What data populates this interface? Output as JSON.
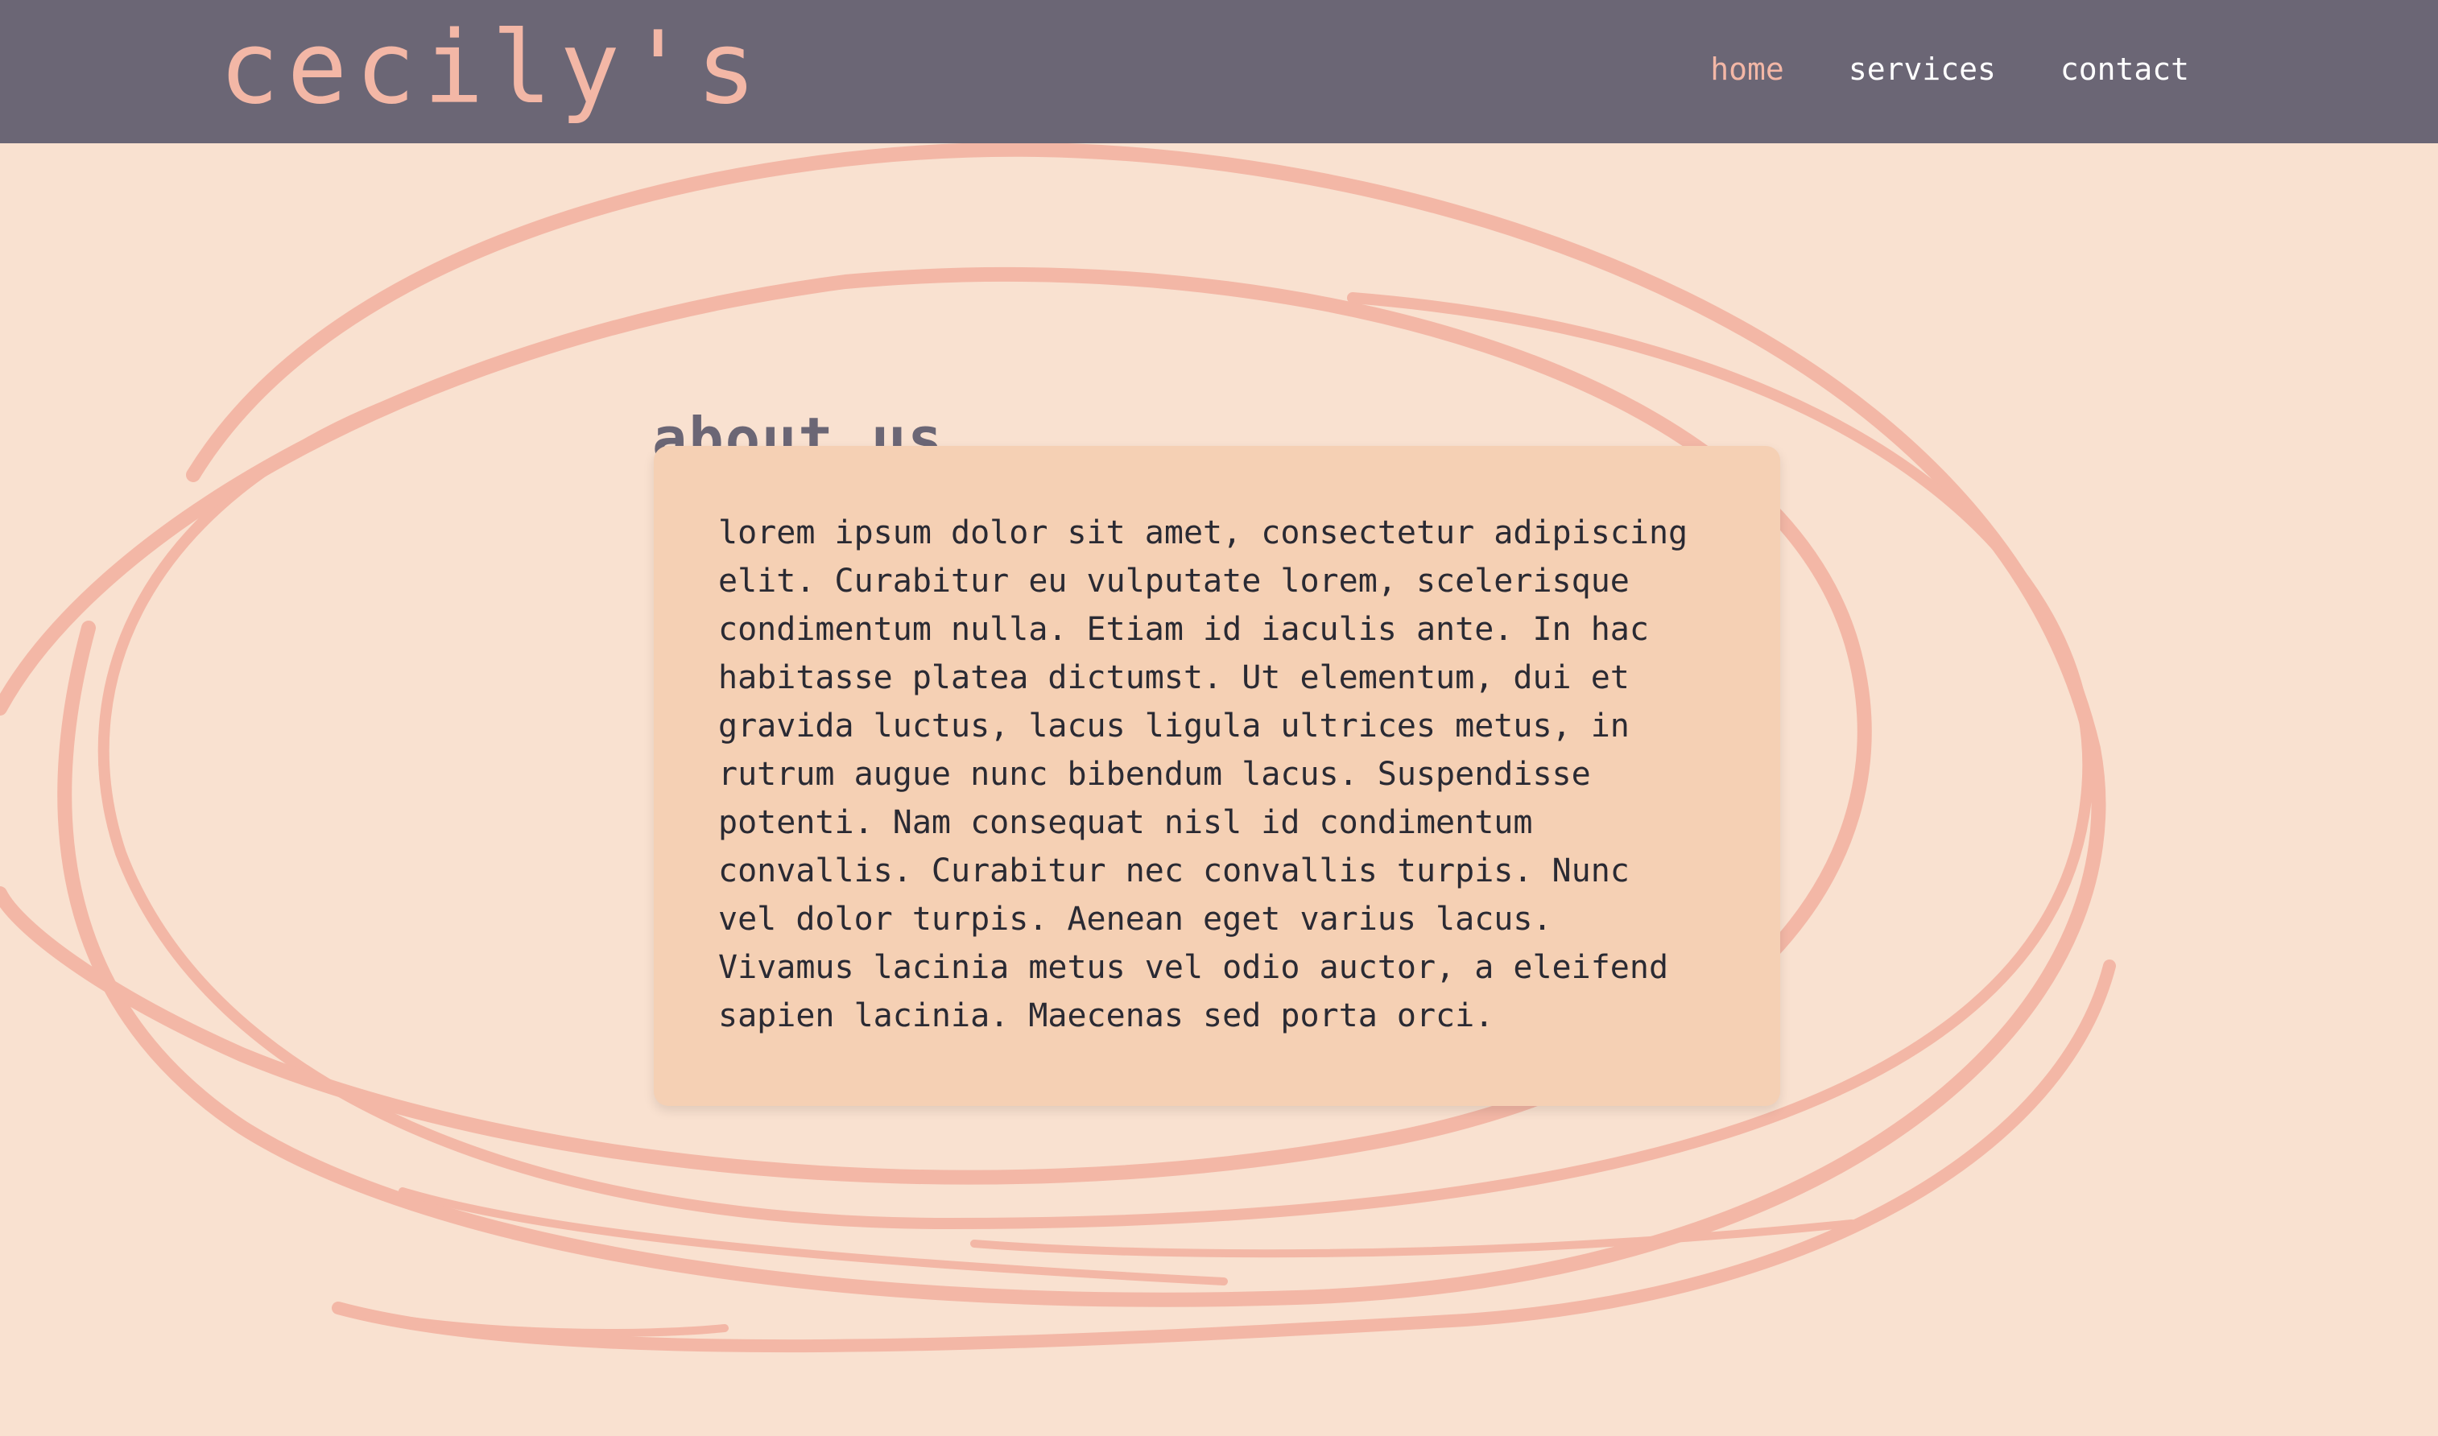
{
  "header": {
    "logo": "cecily's",
    "nav": [
      {
        "label": "home",
        "active": true
      },
      {
        "label": "services",
        "active": false
      },
      {
        "label": "contact",
        "active": false
      }
    ]
  },
  "main": {
    "heading": "about us",
    "body": "lorem ipsum dolor sit amet, consectetur adipiscing\nelit. Curabitur eu vulputate lorem, scelerisque\ncondimentum nulla. Etiam id iaculis ante. In hac\nhabitasse platea dictumst. Ut elementum, dui et\ngravida luctus, lacus ligula ultrices metus, in\nrutrum augue nunc bibendum lacus. Suspendisse\npotenti. Nam consequat nisl id condimentum\nconvallis. Curabitur nec convallis turpis. Nunc\nvel dolor turpis. Aenean eget varius lacus.\nVivamus lacinia metus vel odio auctor, a eleifend\nsapien lacinia. Maecenas sed porta orci."
  },
  "colors": {
    "header_bg": "#6b6675",
    "page_bg": "#f9e1d0",
    "accent": "#f3b7a6",
    "card_bg": "#f5d0b4",
    "text": "#2a2a33"
  }
}
